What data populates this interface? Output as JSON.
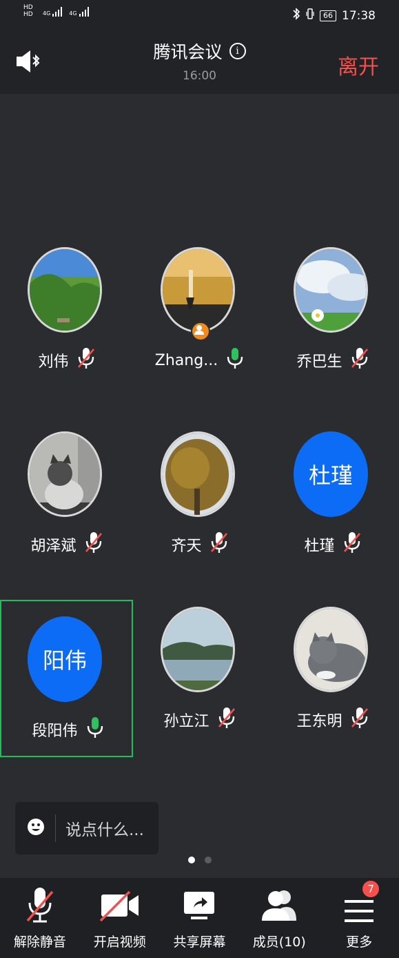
{
  "status_bar": {
    "hd1": "HD",
    "hd2": "HD",
    "net1": "4G",
    "net2": "4G",
    "battery": "66",
    "time": "17:38"
  },
  "header": {
    "title": "腾讯会议",
    "time": "16:00",
    "leave": "离开"
  },
  "participants": [
    {
      "name": "刘伟",
      "initials": "",
      "muted": true,
      "avatar": "photo-landscape"
    },
    {
      "name": "Zhang...",
      "initials": "",
      "muted": false,
      "avatar": "photo-brush",
      "host": true
    },
    {
      "name": "乔巴生",
      "initials": "",
      "muted": true,
      "avatar": "photo-sky"
    },
    {
      "name": "胡泽斌",
      "initials": "",
      "muted": true,
      "avatar": "photo-kitten"
    },
    {
      "name": "齐天",
      "initials": "",
      "muted": true,
      "avatar": "photo-tree"
    },
    {
      "name": "杜瑾",
      "initials": "杜瑾",
      "muted": true,
      "avatar": "initials"
    },
    {
      "name": "段阳伟",
      "initials": "阳伟",
      "muted": false,
      "active": true,
      "avatar": "initials"
    },
    {
      "name": "孙立江",
      "initials": "",
      "muted": true,
      "avatar": "photo-lake"
    },
    {
      "name": "王东明",
      "initials": "",
      "muted": true,
      "avatar": "photo-cat"
    }
  ],
  "chat": {
    "placeholder": "说点什么..."
  },
  "toolbar": {
    "unmute": "解除静音",
    "video": "开启视频",
    "share": "共享屏幕",
    "members": "成员(10)",
    "more": "更多",
    "more_badge": "7"
  },
  "colors": {
    "leave": "#f5504b",
    "avatar_blue": "#0d6cf5",
    "active_border": "#1fbd5b",
    "mic_on": "#2fc15e",
    "mic_off_slash": "#f5504b"
  }
}
